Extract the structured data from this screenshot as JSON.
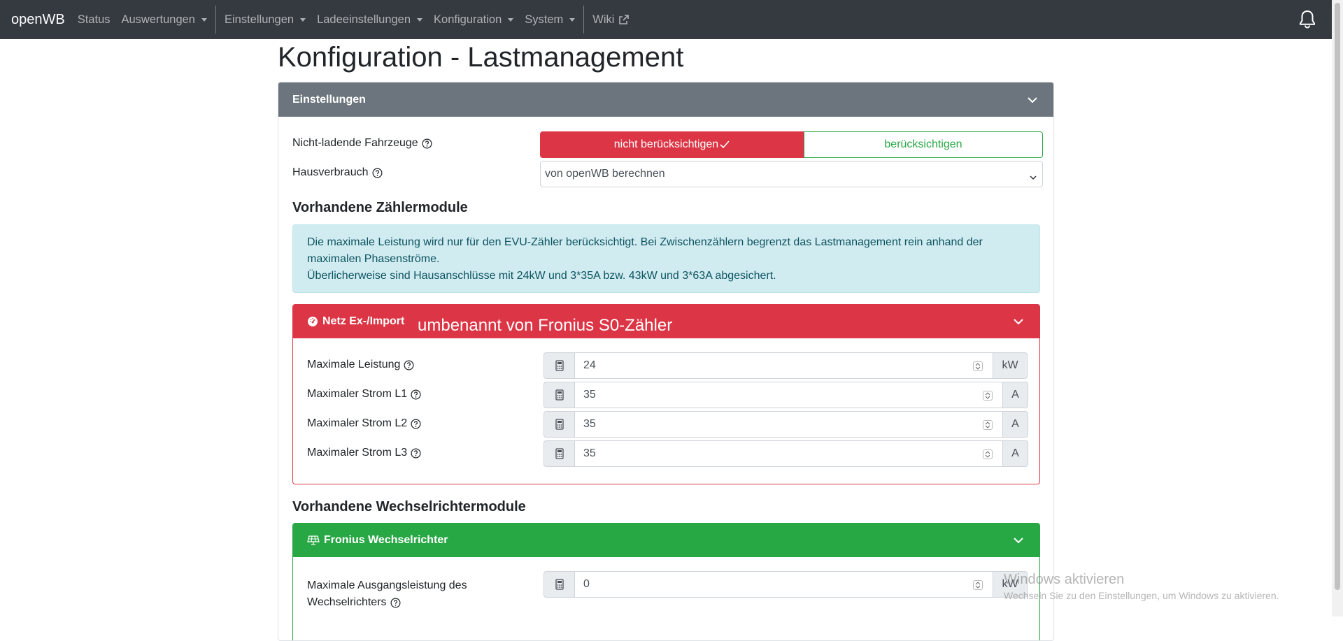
{
  "navbar": {
    "brand": "openWB",
    "items": [
      {
        "label": "Status"
      },
      {
        "label": "Auswertungen"
      },
      {
        "label": "Einstellungen"
      },
      {
        "label": "Ladeeinstellungen"
      },
      {
        "label": "Konfiguration"
      },
      {
        "label": "System"
      },
      {
        "label": "Wiki"
      }
    ],
    "bell_icon": "bell-icon"
  },
  "page": {
    "title": "Konfiguration - Lastmanagement"
  },
  "settings_card": {
    "header": "Einstellungen",
    "nicht_ladende": {
      "label": "Nicht-ladende Fahrzeuge",
      "option_selected": "nicht berücksichtigen",
      "option_other": "berücksichtigen"
    },
    "hausverbrauch": {
      "label": "Hausverbrauch",
      "value": "von openWB berechnen"
    },
    "zaehler_section": "Vorhandene Zählermodule",
    "alert_line1": "Die maximale Leistung wird nur für den EVU-Zähler berücksichtigt. Bei Zwischenzählern begrenzt das Lastmanagement rein anhand der maximalen Phasenströme.",
    "alert_line2": "Überlicherweise sind Hausanschlüsse mit 24kW und 3*35A bzw. 43kW und 3*63A abgesichert.",
    "counter_module": {
      "header": "Netz Ex-/Import",
      "overlay_note": "umbenannt von Fronius S0-Zähler",
      "fields": [
        {
          "label": "Maximale Leistung",
          "value": "24",
          "unit": "kW"
        },
        {
          "label": "Maximaler Strom L1",
          "value": "35",
          "unit": "A"
        },
        {
          "label": "Maximaler Strom L2",
          "value": "35",
          "unit": "A"
        },
        {
          "label": "Maximaler Strom L3",
          "value": "35",
          "unit": "A"
        }
      ]
    },
    "inverter_section": "Vorhandene Wechselrichtermodule",
    "inverter_module": {
      "header": "Fronius Wechselrichter",
      "field_label_line1": "Maximale Ausgangsleistung des",
      "field_label_line2": "Wechselrichters",
      "value": "0",
      "unit": "kW"
    }
  },
  "watermark": {
    "title": "Windows aktivieren",
    "subtitle": "Wechseln Sie zu den Einstellungen, um Windows zu aktivieren."
  },
  "colors": {
    "navbar": "#343a40",
    "danger": "#dc3545",
    "success": "#28a745",
    "secondary": "#6c757d",
    "info_bg": "#d1ecf1"
  }
}
